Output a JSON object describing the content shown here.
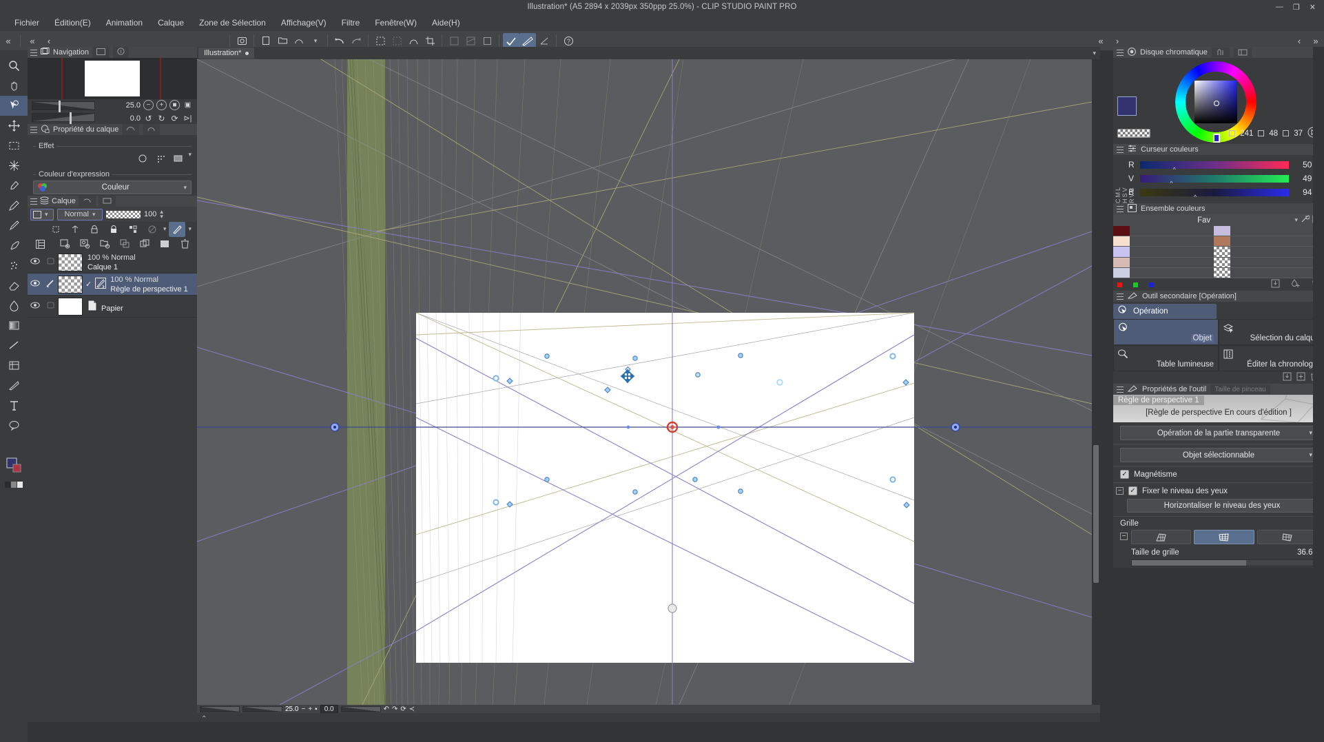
{
  "window": {
    "title": "Illustration* (A5 2894 x 2039px 350ppp 25.0%)  - CLIP STUDIO PAINT PRO",
    "minimize": "—",
    "maximize": "❐",
    "close": "✕"
  },
  "menubar": {
    "items": [
      "Fichier",
      "Édition(E)",
      "Animation",
      "Calque",
      "Zone de Sélection",
      "Affichage(V)",
      "Filtre",
      "Fenêtre(W)",
      "Aide(H)"
    ]
  },
  "navigator": {
    "title": "Navigation",
    "zoom": "25.0",
    "rotation": "0.0"
  },
  "layer_property": {
    "title": "Propriété du calque",
    "effect_legend": "Effet",
    "expr_legend": "Couleur d'expression",
    "expr_value": "Couleur"
  },
  "layer_panel": {
    "title": "Calque",
    "blend_mode": "Normal",
    "opacity": "100",
    "rows": [
      {
        "mode": "100 % Normal",
        "name": "Calque 1",
        "selected": false,
        "thumb": "checker",
        "has_ruler": false
      },
      {
        "mode": "100 % Normal",
        "name": "Règle de perspective  1",
        "selected": true,
        "thumb": "checker",
        "has_ruler": true
      },
      {
        "mode": "",
        "name": "Papier",
        "selected": false,
        "thumb": "white",
        "has_ruler": false
      }
    ]
  },
  "canvas": {
    "tab_label": "Illustration*",
    "zoom": "25.0",
    "rotation": "0.0"
  },
  "color_wheel": {
    "title": "Disque chromatique",
    "h": "241",
    "s": "48",
    "v": "37",
    "fg_color": "#32336e",
    "bg_color": "#b03344"
  },
  "color_slider": {
    "title": "Curseur couleurs",
    "space_labels": "CML HSV RVB",
    "channels": [
      {
        "label": "R",
        "value": "50"
      },
      {
        "label": "V",
        "value": "49"
      },
      {
        "label": "B",
        "value": "94"
      }
    ]
  },
  "color_set": {
    "title": "Ensemble couleurs",
    "set_name": "Fav",
    "swatches": [
      "#5c0f12",
      "#f7dfcd",
      "#c7c2ef",
      "#d6bbb4",
      "#cdd0e2"
    ],
    "swatches_mid": [
      "#c6bcdd",
      "#b0795e",
      "checker",
      "checker",
      "checker"
    ],
    "footer_dots": [
      "#e01a1a",
      "#12d022",
      "#1f22cf"
    ]
  },
  "secondary_tool": {
    "title": "Outil secondaire [Opération]",
    "selected": "Opération",
    "cells": [
      {
        "label": "Objet",
        "selected": true,
        "icon": "object-cursor-icon"
      },
      {
        "label": "Sélection du calque",
        "selected": false,
        "icon": "layer-select-icon"
      },
      {
        "label": "Table lumineuse",
        "selected": false,
        "icon": "lightbox-icon"
      },
      {
        "label": "Éditer la chronologie",
        "selected": false,
        "icon": "timeline-icon"
      }
    ]
  },
  "tool_props": {
    "title": "Propriétés de l'outil",
    "tab2": "Taille de pinceau",
    "preset_name": "Règle de perspective  1",
    "subtitle": "[Règle de perspective En cours d'édition ]",
    "transparent_op": "Opération de la partie transparente",
    "selectable_obj": "Objet sélectionnable",
    "magnetism": "Magnétisme",
    "magnetism_checked": true,
    "fix_eye_level": "Fixer le niveau des yeux",
    "fix_eye_level_checked": true,
    "horizontalize": "Horizontaliser le niveau des yeux",
    "grid_legend": "Grille",
    "grid_selected_index": 1,
    "grid_size_label": "Taille de grille",
    "grid_size_value": "36.6"
  }
}
